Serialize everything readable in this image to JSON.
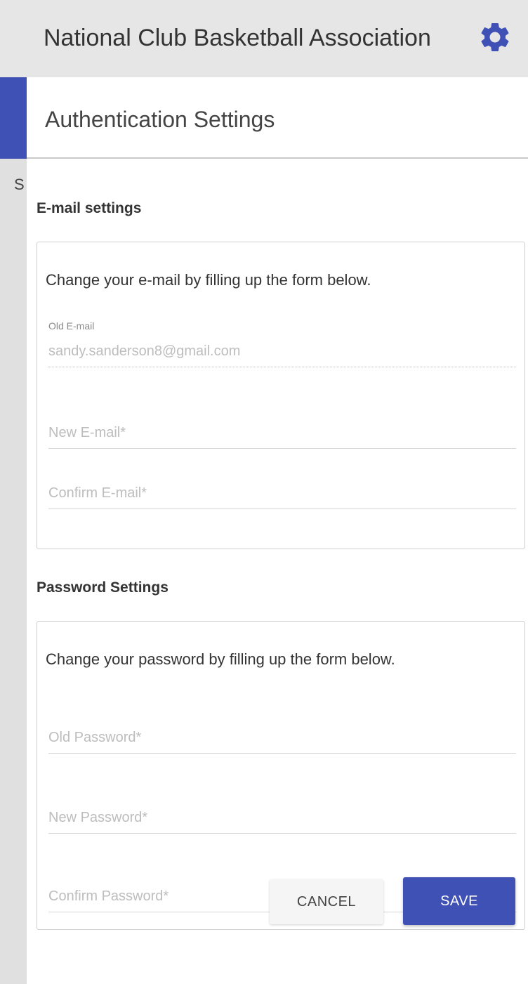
{
  "app": {
    "title": "National Club Basketball Association",
    "settings_icon": "gear-icon",
    "accent_color": "#3f51b5"
  },
  "background": {
    "partial_text": "S"
  },
  "dialog": {
    "title": "Authentication Settings",
    "email_section": {
      "heading": "E-mail settings",
      "description": "Change your e-mail by filling up the form below.",
      "old_email": {
        "label": "Old E-mail",
        "value": "sandy.sanderson8@gmail.com"
      },
      "new_email": {
        "placeholder": "New E-mail*"
      },
      "confirm_email": {
        "placeholder": "Confirm E-mail*"
      }
    },
    "password_section": {
      "heading": "Password Settings",
      "description": "Change your password by filling up the form below.",
      "old_password": {
        "placeholder": "Old Password*"
      },
      "new_password": {
        "placeholder": "New Password*"
      },
      "confirm_password": {
        "placeholder": "Confirm Password*"
      }
    },
    "actions": {
      "cancel_label": "CANCEL",
      "save_label": "SAVE"
    }
  }
}
